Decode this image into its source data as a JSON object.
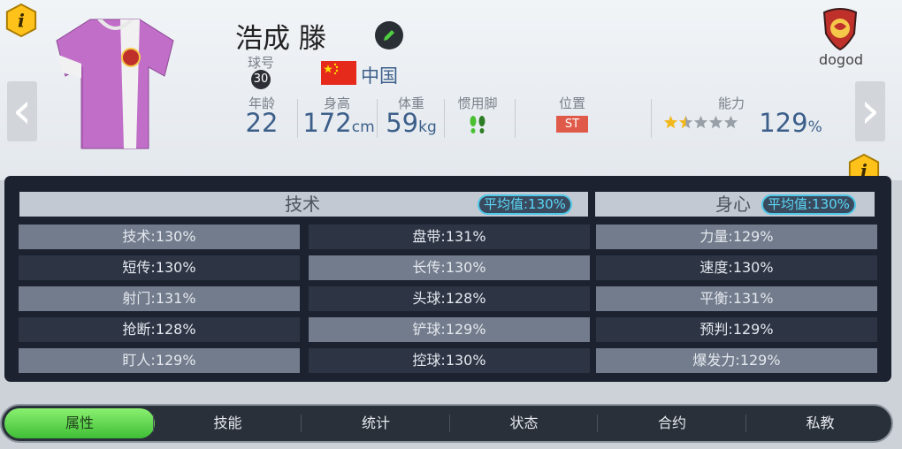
{
  "player": {
    "name": "浩成 滕",
    "number": "30",
    "country": "中国",
    "club": "dogod",
    "labels": {
      "number": "球号",
      "age": "年龄",
      "height": "身高",
      "weight": "体重",
      "foot": "惯用脚",
      "position": "位置",
      "ability": "能力"
    },
    "age": "22",
    "height": "172",
    "height_unit": "cm",
    "weight": "59",
    "weight_unit": "kg",
    "position": "ST",
    "ability": "129",
    "ability_unit": "%",
    "stars": 1.5
  },
  "stats": {
    "tech": {
      "title": "技术",
      "avg": "平均值:130%"
    },
    "body": {
      "title": "身心",
      "avg": "平均值:130%"
    },
    "rows": [
      [
        "技术:130%",
        "盘带:131%",
        "力量:129%"
      ],
      [
        "短传:130%",
        "长传:130%",
        "速度:130%"
      ],
      [
        "射门:131%",
        "头球:128%",
        "平衡:131%"
      ],
      [
        "抢断:128%",
        "铲球:129%",
        "预判:129%"
      ],
      [
        "盯人:129%",
        "控球:130%",
        "爆发力:129%"
      ]
    ]
  },
  "tabs": [
    "属性",
    "技能",
    "统计",
    "状态",
    "合约",
    "私教"
  ],
  "active_tab": 0,
  "colors": {
    "jersey": "#c06ec8",
    "accent": "#ffc21a",
    "badge_bg": "#e05a4a",
    "avg_text": "#5ad8f8",
    "tab_active": "#4fd040"
  },
  "icons": [
    "info-icon",
    "edit-icon",
    "china-flag-icon",
    "boots-icon",
    "club-crest-icon",
    "chevron-left-icon",
    "chevron-right-icon"
  ]
}
